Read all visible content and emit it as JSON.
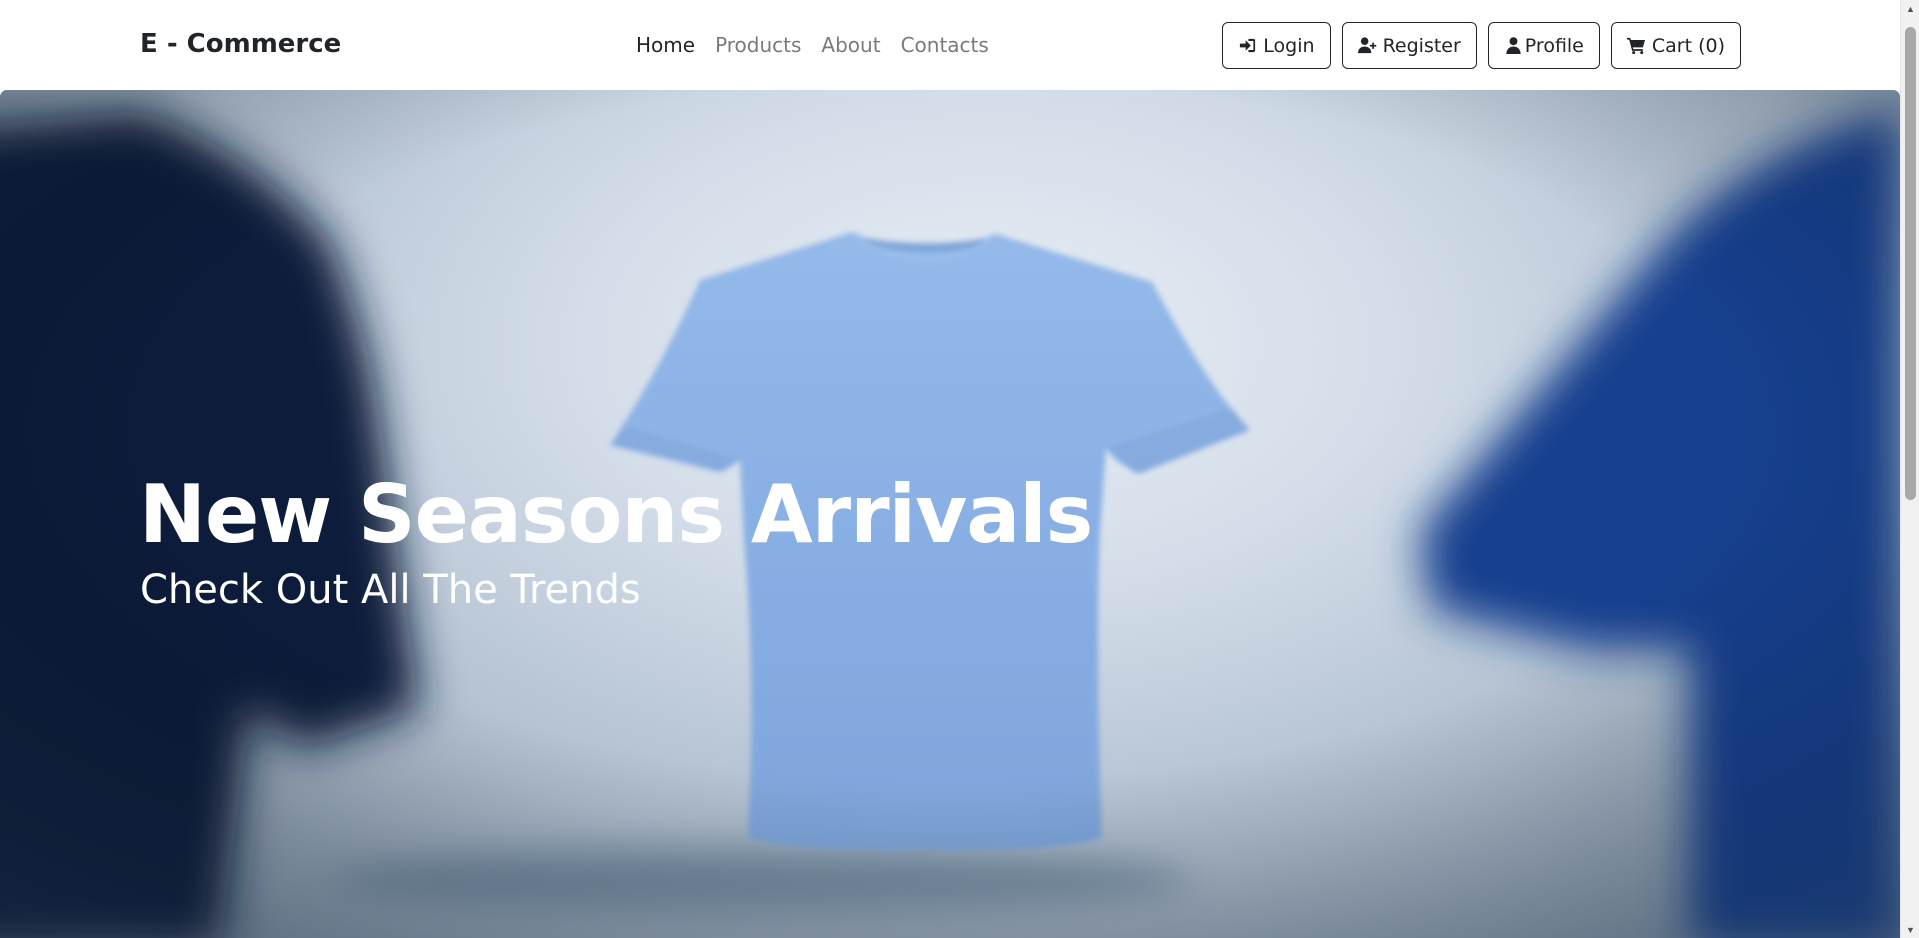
{
  "navbar": {
    "brand": "E - Commerce",
    "links": [
      {
        "label": "Home",
        "active": true
      },
      {
        "label": "Products",
        "active": false
      },
      {
        "label": "About",
        "active": false
      },
      {
        "label": "Contacts",
        "active": false
      }
    ],
    "buttons": {
      "login": {
        "label": "Login",
        "icon": "sign-in-icon"
      },
      "register": {
        "label": "Register",
        "icon": "user-plus-icon"
      },
      "profile": {
        "label": "Profile",
        "icon": "user-icon"
      },
      "cart": {
        "label": "Cart (0)",
        "icon": "cart-icon"
      }
    }
  },
  "hero": {
    "title": "New Seasons Arrivals",
    "subtitle": "Check Out All The Trends",
    "image": "blue-tshirts-banner"
  },
  "colors": {
    "text_dark": "#212529",
    "link_muted": "#7a7a7a",
    "hero_text": "#ffffff",
    "shirt_light_blue": "#8fb4e6",
    "shirt_navy": "#0d1b3a",
    "shirt_royal": "#163f8f"
  }
}
